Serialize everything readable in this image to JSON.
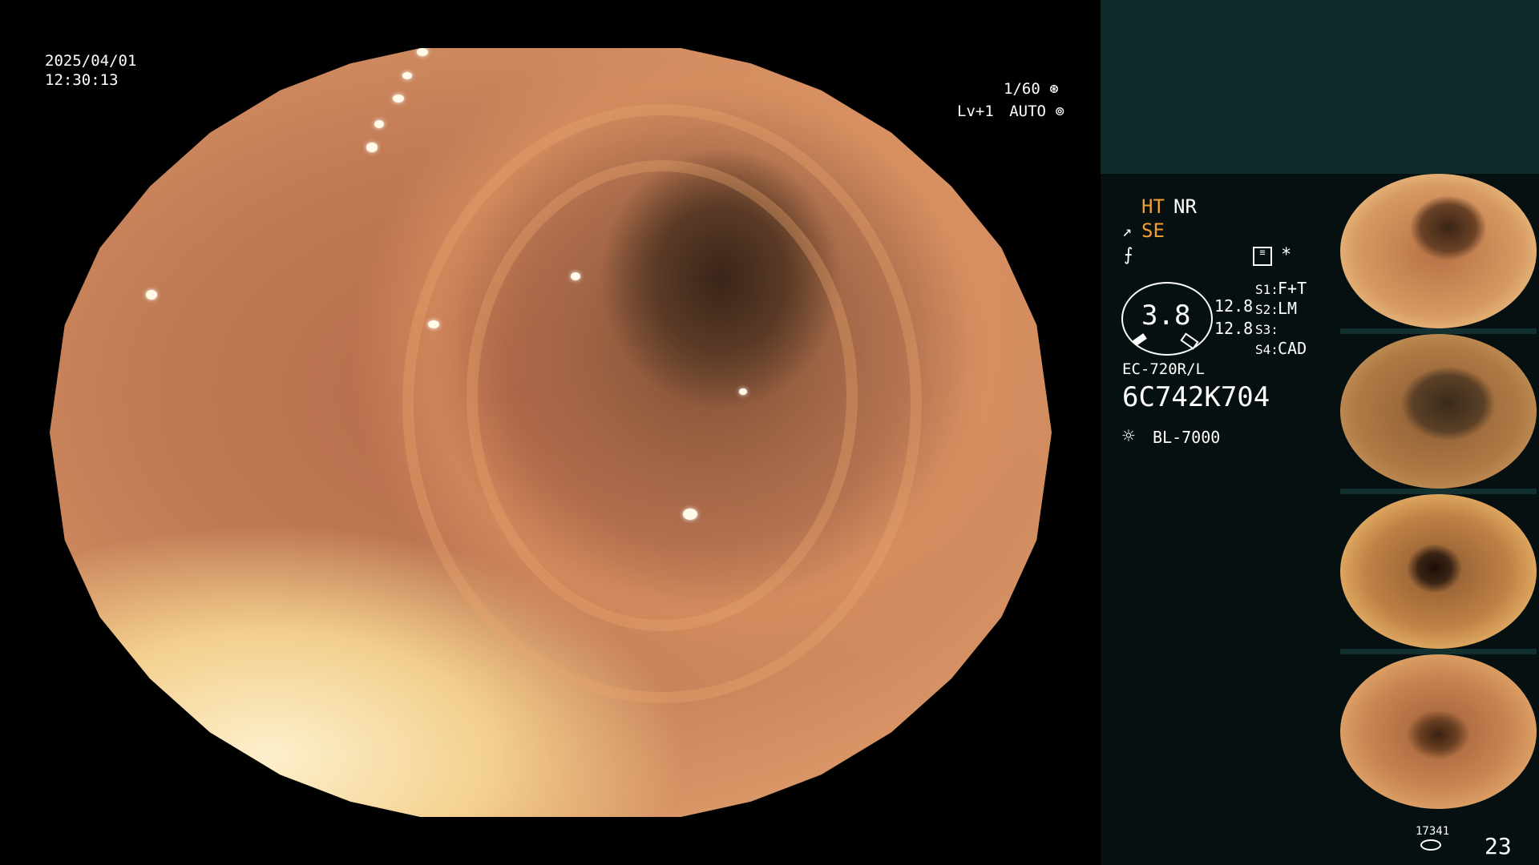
{
  "osd": {
    "date": "2025/04/01",
    "time": "12:30:13",
    "shutter": "1/60",
    "level": "Lv+1",
    "exposure_mode": "AUTO"
  },
  "panel": {
    "ht": "HT",
    "nr": "NR",
    "se": "SE",
    "gauge_value": "3.8",
    "value_1": "12.8",
    "value_2": "12.8",
    "s1": "S1:",
    "s1_value": "F+T",
    "s2": "S2:",
    "s2_value": "LM",
    "s3": "S3:",
    "s3_value": "",
    "s4": "S4:",
    "s4_value": "CAD",
    "scope_model": "EC-720R/L",
    "scope_serial": "6C742K704",
    "light_source": "BL-7000",
    "storage_count": "17341",
    "image_count": "23"
  },
  "colors": {
    "panel_background": "#071010",
    "panel_top_block": "#0d2b2b",
    "accent_orange": "#f0a030",
    "text_white": "#ffffff"
  }
}
